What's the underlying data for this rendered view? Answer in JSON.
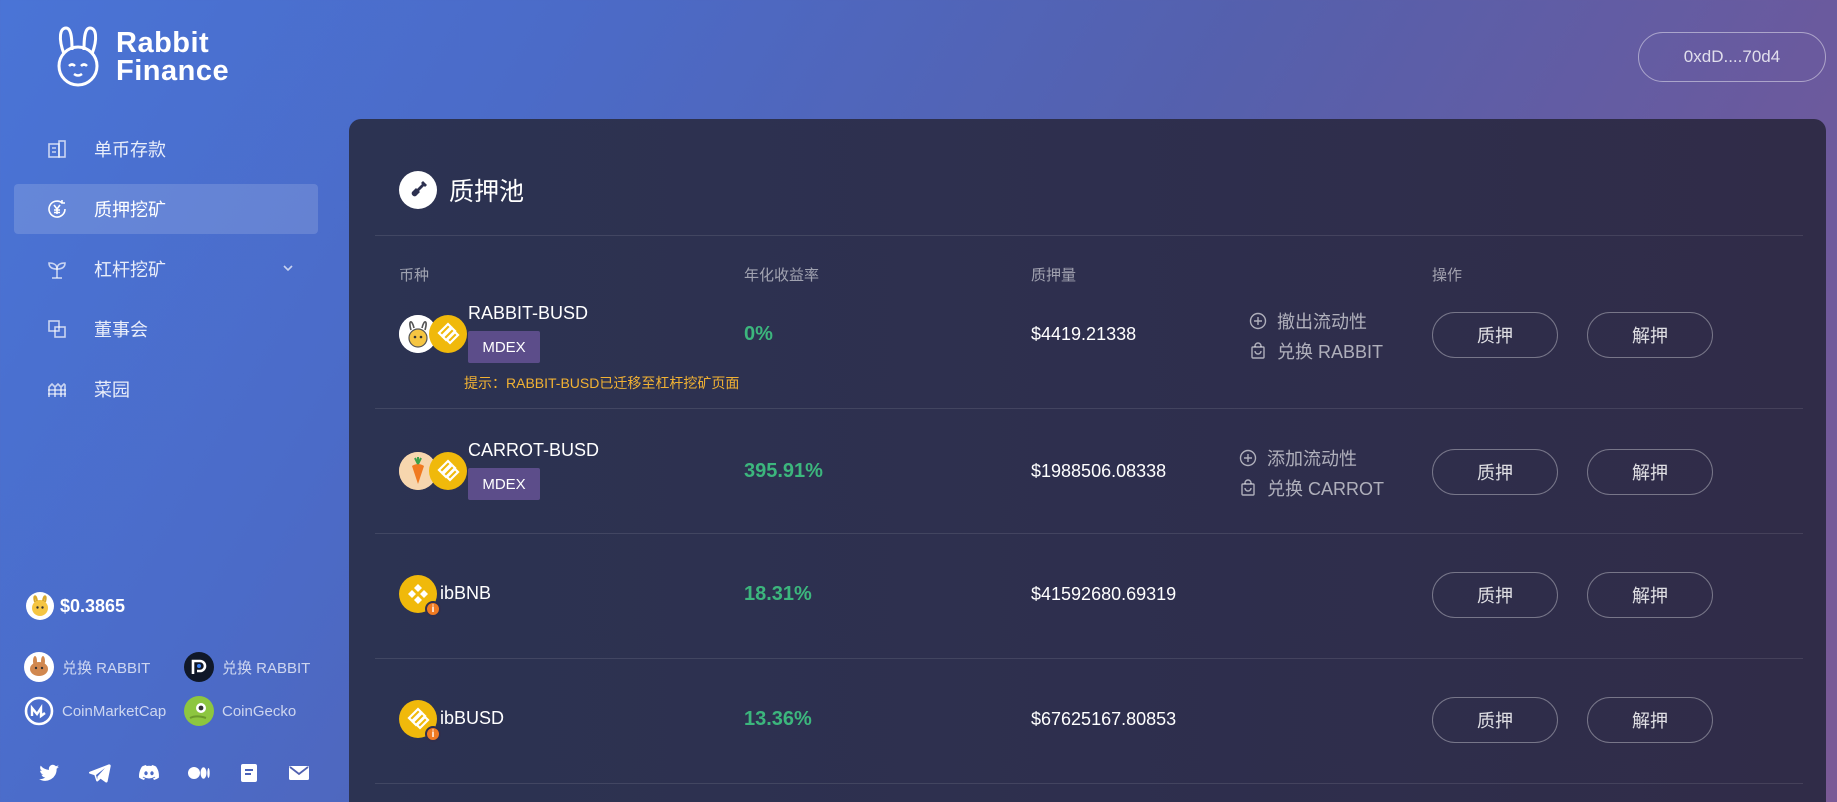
{
  "brand": {
    "line1": "Rabbit",
    "line2": "Finance"
  },
  "wallet": {
    "address": "0xdD....70d4"
  },
  "sidebar": {
    "items": [
      {
        "label": "单币存款",
        "icon": "building-icon",
        "active": false
      },
      {
        "label": "质押挖矿",
        "icon": "yen-refresh-icon",
        "active": true
      },
      {
        "label": "杠杆挖矿",
        "icon": "sprout-icon",
        "active": false,
        "expandable": true
      },
      {
        "label": "董事会",
        "icon": "overlap-squares-icon",
        "active": false
      },
      {
        "label": "菜园",
        "icon": "garden-fence-icon",
        "active": false
      }
    ],
    "price": "$0.3865",
    "links": [
      {
        "label": "兑换 RABBIT",
        "icon": "pancakeswap-icon"
      },
      {
        "label": "兑换 RABBIT",
        "icon": "mdex-icon"
      },
      {
        "label": "CoinMarketCap",
        "icon": "coinmarketcap-icon"
      },
      {
        "label": "CoinGecko",
        "icon": "coingecko-icon"
      }
    ],
    "social": [
      "twitter-icon",
      "telegram-icon",
      "discord-icon",
      "medium-icon",
      "gitbook-icon",
      "mail-icon"
    ]
  },
  "main": {
    "title": "质押池",
    "headers": {
      "coin": "币种",
      "apy": "年化收益率",
      "staked": "质押量",
      "actions": "操作"
    },
    "rows": [
      {
        "name": "RABBIT-BUSD",
        "platform": "MDEX",
        "tip": "提示：RABBIT-BUSD已迁移至杠杆挖矿页面",
        "apy": "0%",
        "staked": "$4419.21338",
        "liquidity": "撤出流动性",
        "swap": "兑换 RABBIT",
        "stake": "质押",
        "unstake": "解押"
      },
      {
        "name": "CARROT-BUSD",
        "platform": "MDEX",
        "apy": "395.91%",
        "staked": "$1988506.08338",
        "liquidity": "添加流动性",
        "swap": "兑换 CARROT",
        "stake": "质押",
        "unstake": "解押"
      },
      {
        "name": "ibBNB",
        "apy": "18.31%",
        "staked": "$41592680.69319",
        "stake": "质押",
        "unstake": "解押"
      },
      {
        "name": "ibBUSD",
        "apy": "13.36%",
        "staked": "$67625167.80853",
        "stake": "质押",
        "unstake": "解押"
      }
    ]
  },
  "colors": {
    "accent_green": "#3cb67d",
    "tip_orange": "#f2b233",
    "mdex_purple": "#5c4d8a",
    "bnb_yellow": "#f0b90b"
  }
}
